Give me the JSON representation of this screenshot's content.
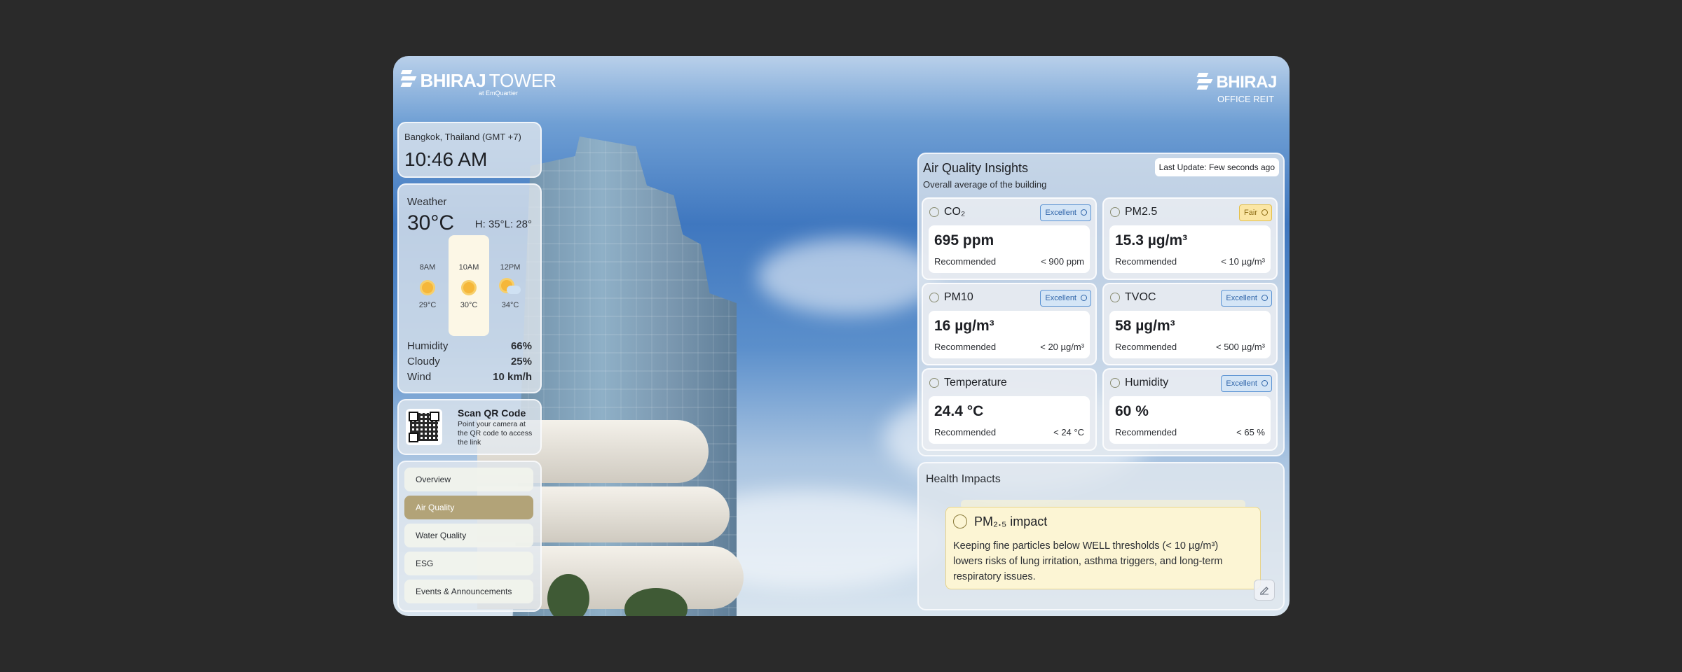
{
  "brand": {
    "left_name": "BHIRAJ",
    "left_name_2": "TOWER",
    "left_sub": "at EmQuartier",
    "right_name": "BHIRAJ",
    "right_sub": "OFFICE REIT"
  },
  "clock": {
    "location": "Bangkok, Thailand (GMT +7)",
    "time": "10:46 AM"
  },
  "weather": {
    "title": "Weather",
    "temp": "30°C",
    "high_low": "H: 35°L: 28°",
    "hours": [
      {
        "label": "8AM",
        "icon": "sun-icon",
        "temp": "29°C"
      },
      {
        "label": "10AM",
        "icon": "sun-icon",
        "temp": "30°C"
      },
      {
        "label": "12PM",
        "icon": "partly-cloudy-icon",
        "temp": "34°C"
      }
    ],
    "stats": [
      {
        "label": "Humidity",
        "value": "66%"
      },
      {
        "label": "Cloudy",
        "value": "25%"
      },
      {
        "label": "Wind",
        "value": "10 km/h"
      }
    ]
  },
  "qr": {
    "title": "Scan QR Code",
    "desc": "Point your camera at the QR code to access the link"
  },
  "nav": {
    "items": [
      "Overview",
      "Air Quality",
      "Water Quality",
      "ESG",
      "Events & Announcements"
    ],
    "active": "Air Quality"
  },
  "air_quality": {
    "title": "Air Quality Insights",
    "subtitle": "Overall average of the building",
    "last_update": "Last Update: Few seconds ago",
    "recommended_label": "Recommended",
    "cards": [
      {
        "name": "CO₂",
        "badge": "Excellent",
        "status": "excellent",
        "value": "695 ppm",
        "rec": "< 900 ppm"
      },
      {
        "name": "PM2.5",
        "badge": "Fair",
        "status": "fair",
        "value": "15.3 µg/m³",
        "rec": "< 10 µg/m³"
      },
      {
        "name": "PM10",
        "badge": "Excellent",
        "status": "excellent",
        "value": "16 µg/m³",
        "rec": "< 20 µg/m³"
      },
      {
        "name": "TVOC",
        "badge": "Excellent",
        "status": "excellent",
        "value": "58 µg/m³",
        "rec": "< 500 µg/m³"
      },
      {
        "name": "Temperature",
        "badge": "",
        "status": "none",
        "value": "24.4 °C",
        "rec": "< 24 °C"
      },
      {
        "name": "Humidity",
        "badge": "Excellent",
        "status": "excellent",
        "value": "60 %",
        "rec": "< 65 %"
      }
    ]
  },
  "health": {
    "title": "Health Impacts",
    "card_title": "PM₂.₅ impact",
    "card_body": "Keeping fine particles below WELL thresholds (< 10 µg/m³) lowers risks of lung irritation, asthma triggers, and long-term respiratory issues."
  },
  "colors": {
    "accent_active": "#b2a378",
    "excellent": "#5b93d3",
    "fair": "#e3bf4a"
  }
}
